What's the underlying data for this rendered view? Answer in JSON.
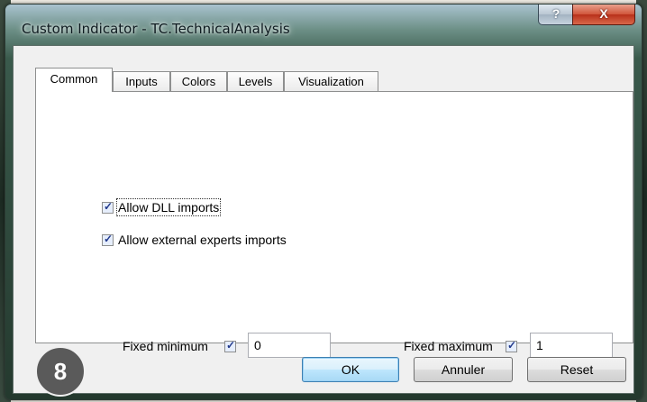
{
  "window": {
    "title": "Custom Indicator - TC.TechnicalAnalysis",
    "help_label": "?",
    "close_label": "X"
  },
  "tabs": [
    {
      "label": "Common",
      "active": true
    },
    {
      "label": "Inputs",
      "active": false
    },
    {
      "label": "Colors",
      "active": false
    },
    {
      "label": "Levels",
      "active": false
    },
    {
      "label": "Visualization",
      "active": false
    }
  ],
  "common": {
    "allow_dll": {
      "label": "Allow DLL imports",
      "checked": true
    },
    "allow_external": {
      "label": "Allow external experts imports",
      "checked": true
    },
    "fixed_minimum": {
      "label": "Fixed minimum",
      "checked": true,
      "value": "0"
    },
    "fixed_maximum": {
      "label": "Fixed maximum",
      "checked": true,
      "value": "1"
    }
  },
  "buttons": {
    "ok": "OK",
    "cancel": "Annuler",
    "reset": "Reset"
  },
  "badge": "8"
}
